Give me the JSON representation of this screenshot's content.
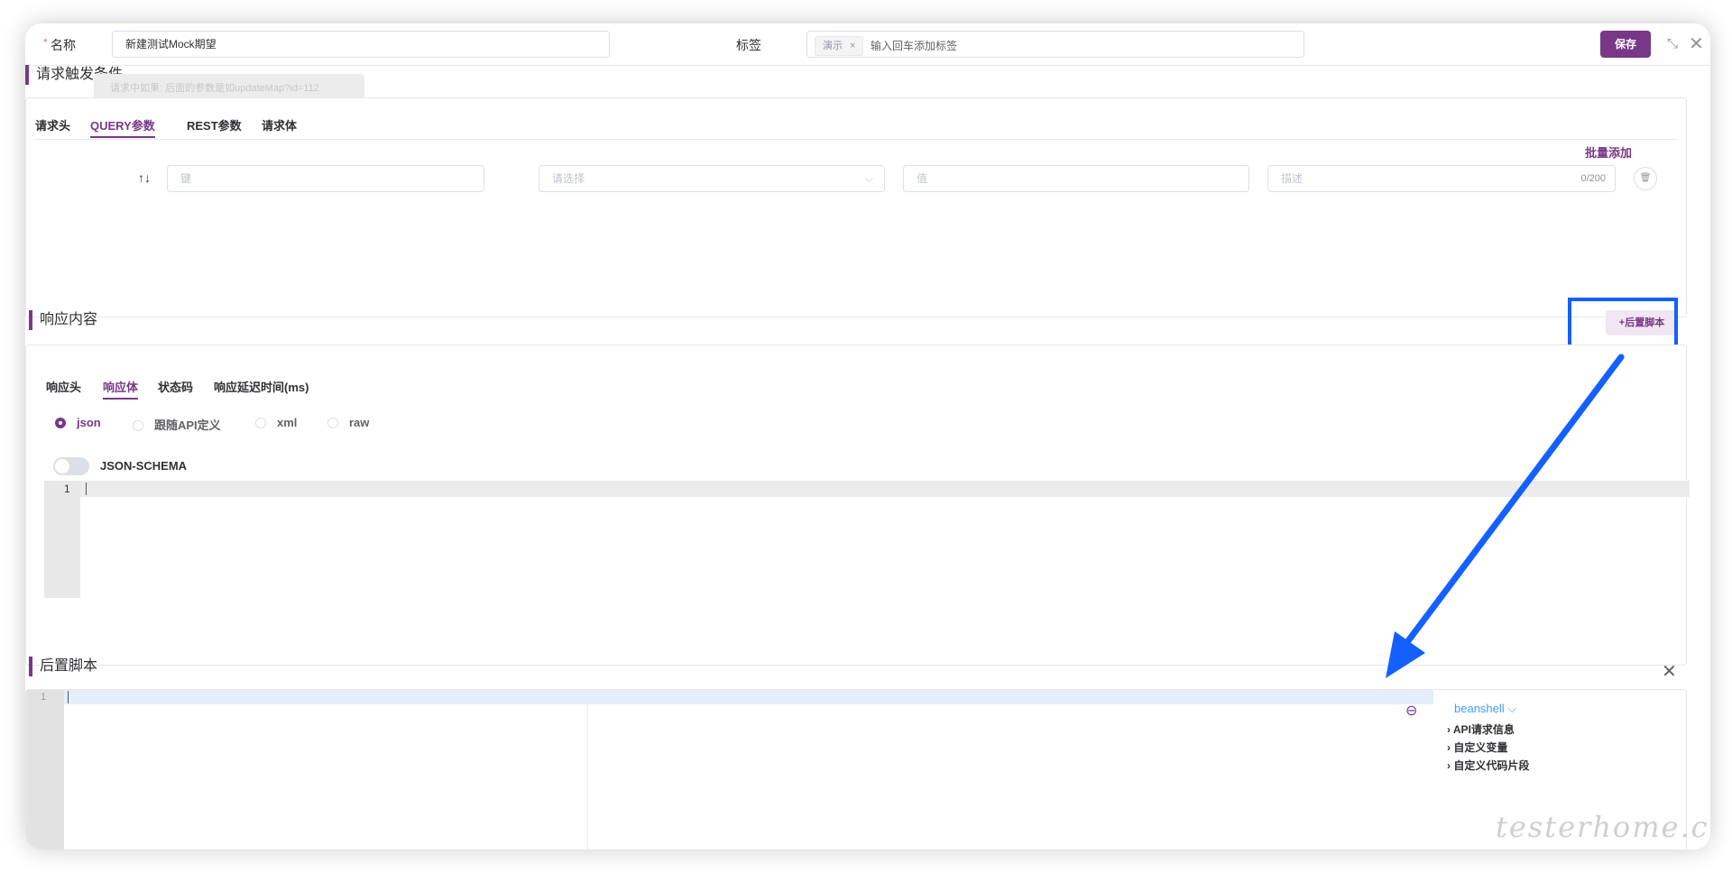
{
  "header": {
    "required_mark": "*",
    "name_label": "名称",
    "name_value": "新建测试Mock期望",
    "tags_label": "标签",
    "tag_chip": "演示",
    "tag_remove": "×",
    "tag_placeholder": "输入回车添加标签",
    "save_label": "保存",
    "shrink_icon": "⤡",
    "close_icon": "✕"
  },
  "request_section": {
    "title": "请求触发条件",
    "tooltip": "请求中如果: 后面的参数是如updateMap?id=112",
    "tabs": [
      "请求头",
      "QUERY参数",
      "REST参数",
      "请求体"
    ],
    "active_tab": "QUERY参数",
    "batch_add": "批量添加",
    "row": {
      "sort_icon": "↑↓",
      "key_placeholder": "键",
      "select_placeholder": "请选择",
      "select_chevron": "⌵",
      "value_placeholder": "值",
      "desc_placeholder": "描述",
      "desc_counter": "0/200",
      "delete_icon": "🗑"
    }
  },
  "response_section": {
    "title": "响应内容",
    "post_script_button": "+后置脚本",
    "tabs": [
      "响应头",
      "响应体",
      "状态码",
      "响应延迟时间(ms)"
    ],
    "active_tab": "响应体",
    "body_types": [
      "json",
      "跟随API定义",
      "xml",
      "raw"
    ],
    "selected_body_type": "json",
    "json_schema_label": "JSON-SCHEMA",
    "json_schema_enabled": false,
    "editor_line_number": "1"
  },
  "post_script_section": {
    "title": "后置脚本",
    "close_icon": "✕",
    "editor_line_number": "1",
    "minus_icon": "⊖",
    "language": "beanshell",
    "language_chevron": "⌵",
    "tree": [
      "API请求信息",
      "自定义变量",
      "自定义代码片段"
    ],
    "tree_chevron": "›"
  },
  "annotation": {
    "highlight_color": "#1460ff",
    "arrow_color": "#1460ff"
  },
  "watermark": "testerhome.com",
  "colors": {
    "brand": "#783887",
    "link": "#409eff"
  }
}
